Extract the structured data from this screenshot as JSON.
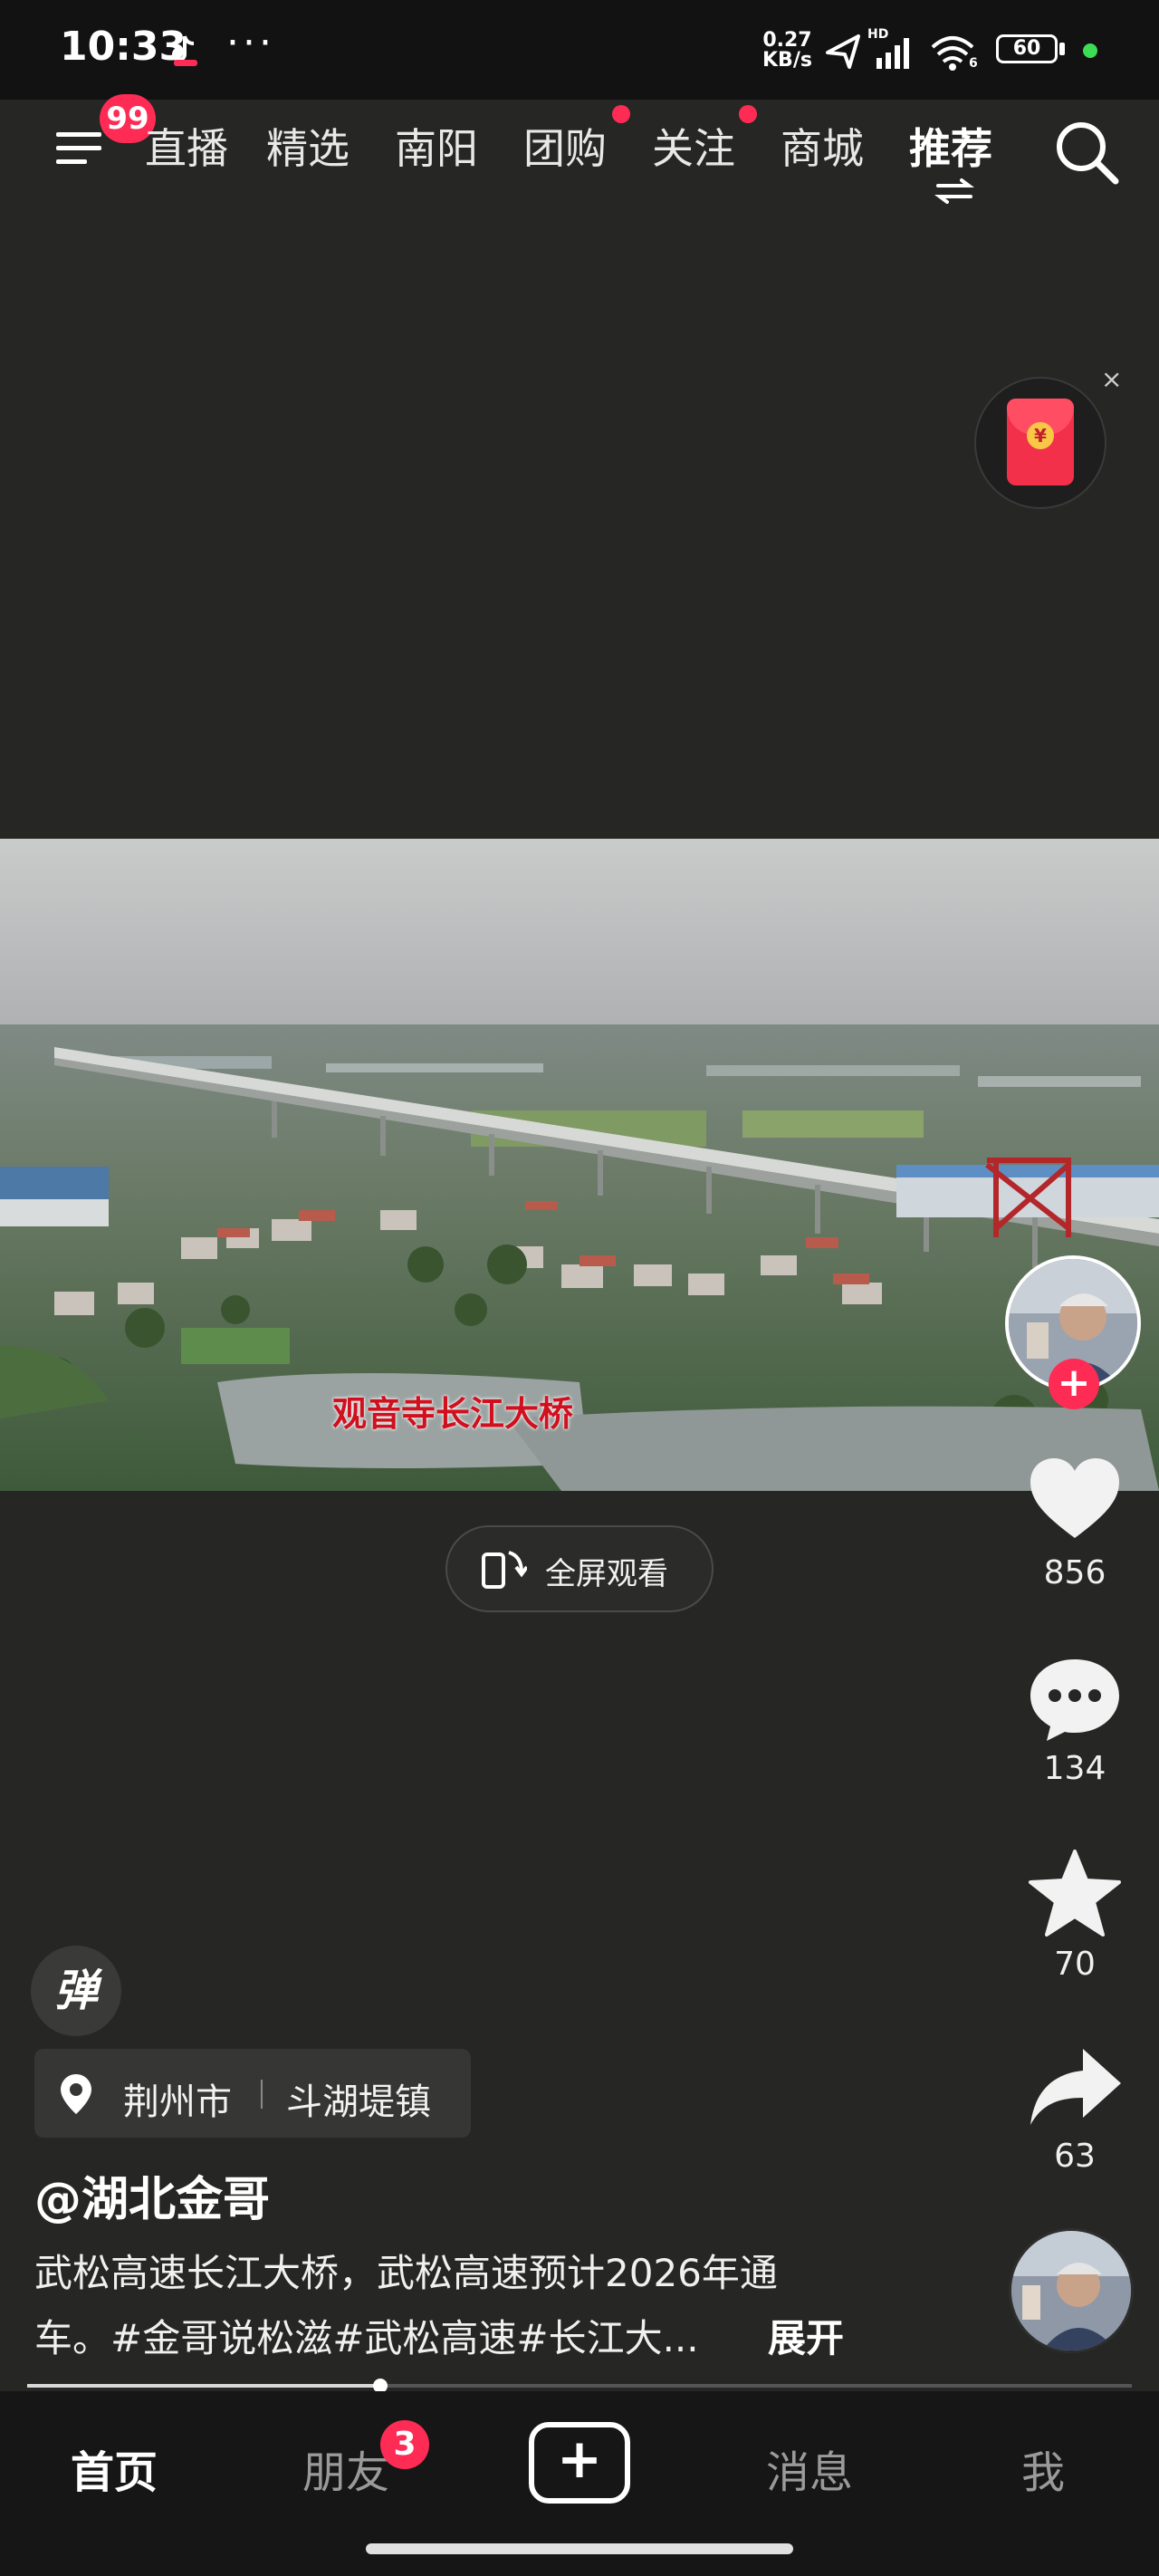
{
  "status_bar": {
    "time": "10:33",
    "dots": "···",
    "net_speed_value": "0.27",
    "net_speed_unit": "KB/s",
    "signal_tag": "HD",
    "wifi_tag": "6",
    "battery": "60"
  },
  "top_nav": {
    "menu_badge": "99",
    "tabs": [
      {
        "label": "直播",
        "active": false,
        "dot": false
      },
      {
        "label": "精选",
        "active": false,
        "dot": false
      },
      {
        "label": "南阳",
        "active": false,
        "dot": false
      },
      {
        "label": "团购",
        "active": false,
        "dot": true
      },
      {
        "label": "关注",
        "active": false,
        "dot": true
      },
      {
        "label": "商城",
        "active": false,
        "dot": false
      },
      {
        "label": "推荐",
        "active": true,
        "dot": false
      }
    ]
  },
  "red_packet": {
    "close": "×",
    "coin": "¥"
  },
  "video": {
    "subtitle": "观音寺长江大桥",
    "fullscreen_label": "全屏观看"
  },
  "actions": {
    "likes": "856",
    "comments": "134",
    "favorites": "70",
    "shares": "63"
  },
  "danmu_label": "弹",
  "location": {
    "city": "荆州市",
    "town": "斗湖堤镇"
  },
  "author": "@湖北金哥",
  "description": {
    "line1": "武松高速长江大桥，武松高速预计2026年通",
    "line2": "车。#金哥说松滋#武松高速#长江大...",
    "expand": "展开"
  },
  "progress": 0.32,
  "bottom_nav": {
    "home": "首页",
    "friends": "朋友",
    "friends_badge": "3",
    "add": "+",
    "messages": "消息",
    "me": "我"
  },
  "colors": {
    "accent": "#fe2c55",
    "background": "#262624",
    "subtitle": "#d0101e"
  }
}
